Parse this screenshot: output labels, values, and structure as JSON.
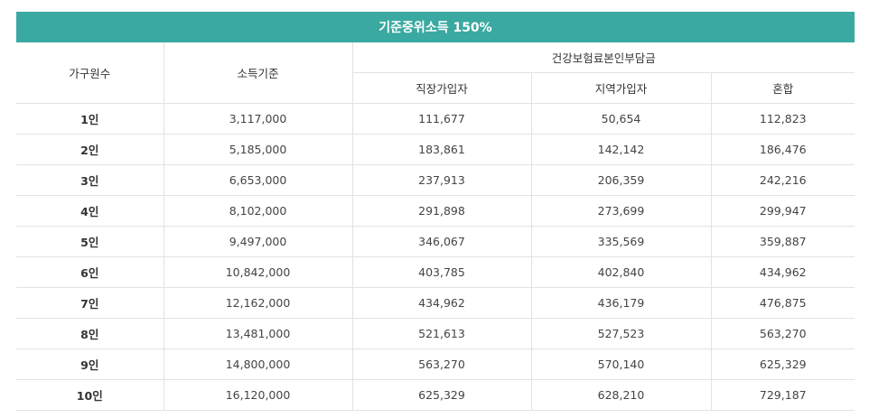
{
  "table": {
    "title": "기준중위소득 150%",
    "col_household": "가구원수",
    "col_income": "소득기준",
    "col_insurance_group": "건강보험료본인부담금",
    "col_employee": "직장가입자",
    "col_regional": "지역가입자",
    "col_mixed": "혼합",
    "rows": [
      {
        "household": "1인",
        "income": "3,117,000",
        "employee": "111,677",
        "regional": "50,654",
        "mixed": "112,823"
      },
      {
        "household": "2인",
        "income": "5,185,000",
        "employee": "183,861",
        "regional": "142,142",
        "mixed": "186,476"
      },
      {
        "household": "3인",
        "income": "6,653,000",
        "employee": "237,913",
        "regional": "206,359",
        "mixed": "242,216"
      },
      {
        "household": "4인",
        "income": "8,102,000",
        "employee": "291,898",
        "regional": "273,699",
        "mixed": "299,947"
      },
      {
        "household": "5인",
        "income": "9,497,000",
        "employee": "346,067",
        "regional": "335,569",
        "mixed": "359,887"
      },
      {
        "household": "6인",
        "income": "10,842,000",
        "employee": "403,785",
        "regional": "402,840",
        "mixed": "434,962"
      },
      {
        "household": "7인",
        "income": "12,162,000",
        "employee": "434,962",
        "regional": "436,179",
        "mixed": "476,875"
      },
      {
        "household": "8인",
        "income": "13,481,000",
        "employee": "521,613",
        "regional": "527,523",
        "mixed": "563,270"
      },
      {
        "household": "9인",
        "income": "14,800,000",
        "employee": "563,270",
        "regional": "570,140",
        "mixed": "625,329"
      },
      {
        "household": "10인",
        "income": "16,120,000",
        "employee": "625,329",
        "regional": "628,210",
        "mixed": "729,187"
      }
    ]
  }
}
